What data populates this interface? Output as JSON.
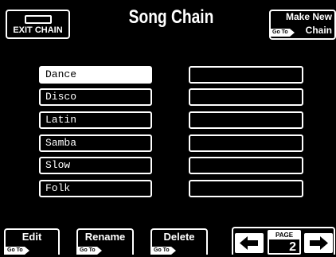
{
  "header": {
    "title": "Song Chain",
    "exit_label": "EXIT CHAIN",
    "make_new_line1": "Make New",
    "make_new_line2": "Chain",
    "goto": "Go To"
  },
  "chain_list": {
    "selected_index": 0,
    "items": [
      "Dance",
      "Disco",
      "Latin",
      "Samba",
      "Slow",
      "Folk"
    ]
  },
  "footer": {
    "edit_label": "Edit",
    "rename_label": "Rename",
    "delete_label": "Delete",
    "goto": "Go To",
    "page_label": "PAGE",
    "page_number": "2"
  }
}
